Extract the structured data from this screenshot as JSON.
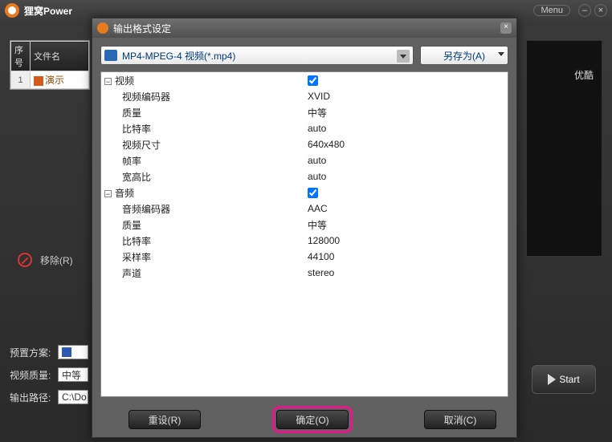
{
  "mainWindow": {
    "title": "狸窝Power",
    "menuLabel": "Menu",
    "previewLabel": "优酷",
    "removeLabel": "移除(R)",
    "start": "Start",
    "settings": {
      "presetLabel": "预置方案:",
      "videoQualityLabel": "视频质量:",
      "videoQualityValue": "中等",
      "outputPathLabel": "输出路径:",
      "outputPathValue": "C:\\Do"
    },
    "fileTable": {
      "colNum": "序号",
      "colName": "文件名",
      "rows": [
        {
          "num": "1",
          "name": "演示"
        }
      ]
    }
  },
  "dialog": {
    "title": "输出格式设定",
    "formatCombo": "MP4-MPEG-4 视频(*.mp4)",
    "saveAs": "另存为(A)",
    "buttons": {
      "reset": "重设(R)",
      "ok": "确定(O)",
      "cancel": "取消(C)"
    },
    "groups": {
      "video": {
        "label": "视频",
        "checked": true,
        "rows": [
          {
            "label": "视频编码器",
            "value": "XVID"
          },
          {
            "label": "质量",
            "value": "中等"
          },
          {
            "label": "比特率",
            "value": "auto"
          },
          {
            "label": "视频尺寸",
            "value": "640x480"
          },
          {
            "label": "帧率",
            "value": "auto"
          },
          {
            "label": "宽高比",
            "value": "auto"
          }
        ]
      },
      "audio": {
        "label": "音频",
        "checked": true,
        "rows": [
          {
            "label": "音频编码器",
            "value": "AAC"
          },
          {
            "label": "质量",
            "value": "中等"
          },
          {
            "label": "比特率",
            "value": "128000"
          },
          {
            "label": "采样率",
            "value": "44100"
          },
          {
            "label": "声道",
            "value": "stereo"
          }
        ]
      }
    }
  }
}
